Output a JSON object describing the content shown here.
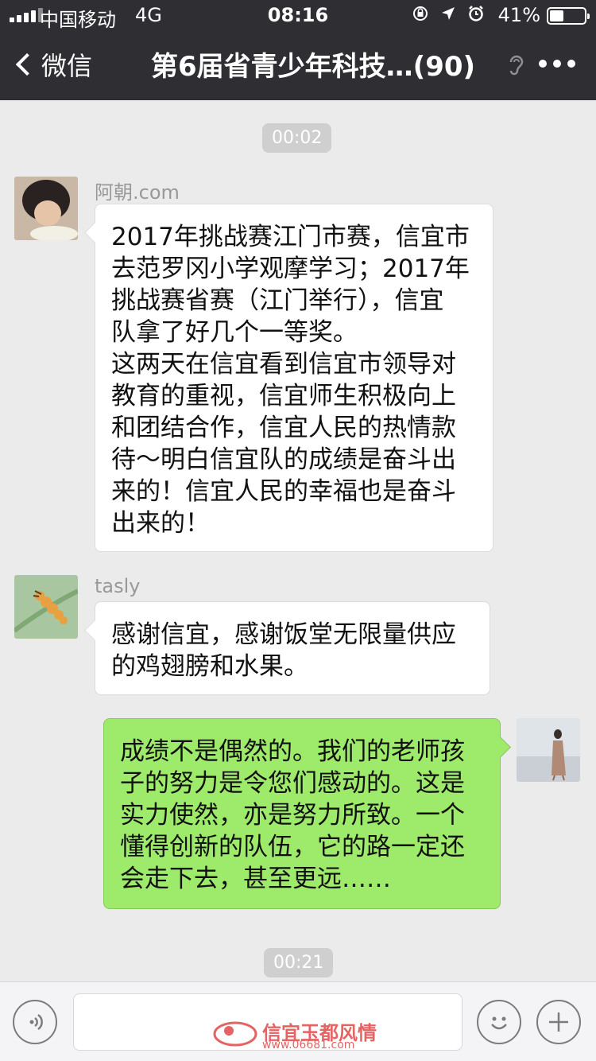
{
  "status_bar": {
    "carrier": "中国移动",
    "network": "4G",
    "time": "08:16",
    "battery": "41%",
    "battery_level": 0.41
  },
  "nav": {
    "back_label": "微信",
    "title": "第6届省青少年科技…(90)"
  },
  "chat": {
    "timestamps": [
      "00:02",
      "00:21"
    ],
    "messages": [
      {
        "sender": "阿朝.com",
        "side": "left",
        "text": "2017年挑战赛江门市赛，信宜市\n去范罗冈小学观摩学习；2017年\n挑战赛省赛（江门举行），信宜\n队拿了好几个一等奖。\n这两天在信宜看到信宜市领导对\n教育的重视，信宜师生积极向上\n和团结合作，信宜人民的热情款\n待～明白信宜队的成绩是奋斗出\n来的！信宜人民的幸福也是奋斗\n出来的！"
      },
      {
        "sender": "tasly",
        "side": "left",
        "text": "感谢信宜，感谢饭堂无限量供应\n的鸡翅膀和水果。"
      },
      {
        "sender": "",
        "side": "right",
        "text": "成绩不是偶然的。我们的老师孩\n子的努力是令您们感动的。这是\n实力使然，亦是努力所致。一个\n懂得创新的队伍，它的路一定还\n会走下去，甚至更远……"
      }
    ]
  },
  "watermark": {
    "text": "信宜玉都风情",
    "url": "www.06681.com"
  },
  "colors": {
    "header": "#2e2e33",
    "chat_bg": "#ebebeb",
    "sent_bubble": "#9eea6a",
    "received_bubble": "#ffffff"
  },
  "icons": [
    "voice-input-icon",
    "emoji-icon",
    "plus-icon",
    "more-icon",
    "ear-icon",
    "back-chevron-icon"
  ]
}
